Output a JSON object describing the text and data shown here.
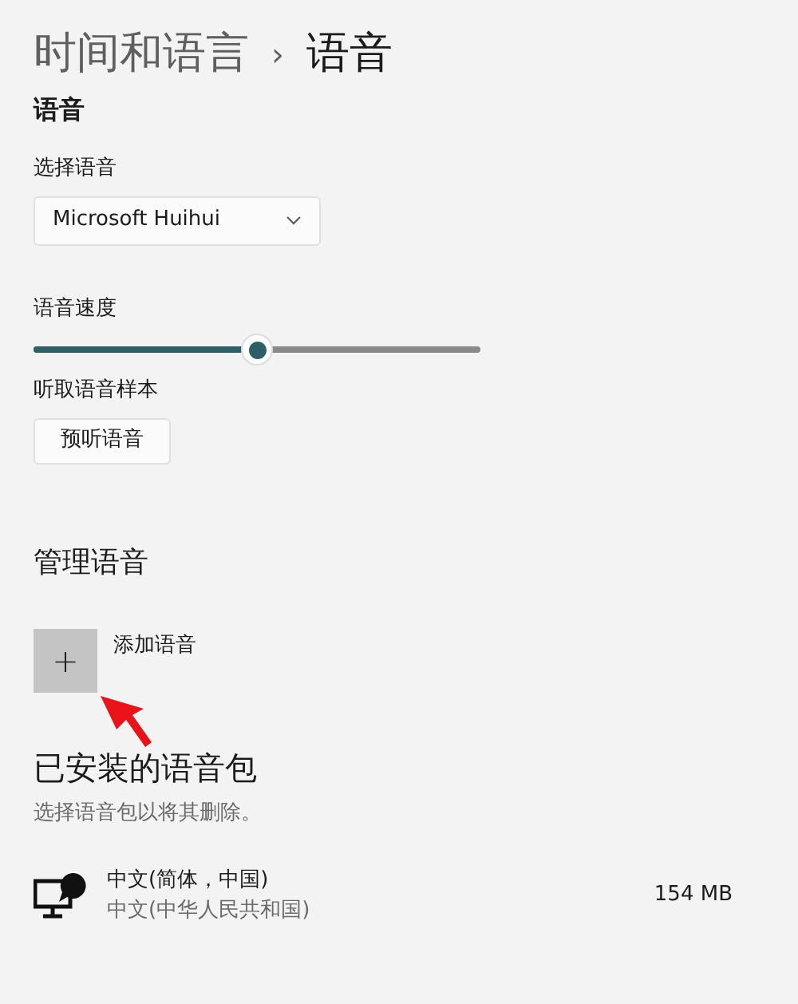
{
  "breadcrumb": {
    "parent": "时间和语言",
    "separator": "›",
    "current": "语音"
  },
  "voice_section": {
    "title": "语音",
    "select_label": "选择语音",
    "selected_voice": "Microsoft Huihui",
    "speed_label": "语音速度",
    "speed": {
      "level": 0.5
    },
    "sample_label": "听取语音样本",
    "preview_button": "预听语音"
  },
  "manage_section": {
    "title": "管理语音",
    "add_button": "+",
    "add_label": "添加语音"
  },
  "installed": {
    "title": "已安装的语音包",
    "subtitle": "选择语音包以将其删除。",
    "packs": [
      {
        "name": "中文(简体，中国)",
        "region": "中文(中华人民共和国)",
        "size": "154 MB"
      }
    ]
  }
}
